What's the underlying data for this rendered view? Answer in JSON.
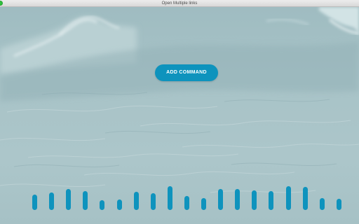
{
  "window": {
    "title": "Open Multiple links"
  },
  "main": {
    "add_command_label": "ADD COMMAND"
  },
  "colors": {
    "accent": "#0e93bd",
    "background": "#a9c4c8"
  },
  "visualizer": {
    "levels": [
      0.55,
      0.65,
      0.85,
      0.72,
      0.22,
      0.28,
      0.68,
      0.62,
      1.0,
      0.45,
      0.35,
      0.85,
      0.85,
      0.78,
      0.75,
      1.0,
      0.95,
      0.35,
      0.3
    ]
  }
}
